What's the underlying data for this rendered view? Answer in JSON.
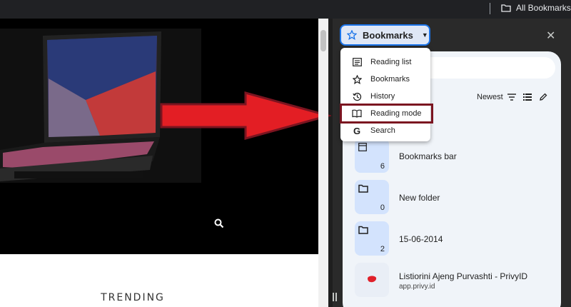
{
  "topbar": {
    "all_bookmarks_label": "All Bookmarks"
  },
  "webpage": {
    "trending_label": "TRENDING"
  },
  "side_panel": {
    "selector_label": "Bookmarks",
    "sort_label": "Newest",
    "menu": [
      {
        "label": "Reading list",
        "icon": "reading-list-icon"
      },
      {
        "label": "Bookmarks",
        "icon": "star-icon"
      },
      {
        "label": "History",
        "icon": "history-icon"
      },
      {
        "label": "Reading mode",
        "icon": "reading-mode-icon",
        "highlighted": true
      },
      {
        "label": "Search",
        "icon": "google-g-icon"
      }
    ],
    "bookmarks": [
      {
        "title": "Bookmarks bar",
        "count": "6"
      },
      {
        "title": "New folder",
        "count": "0"
      },
      {
        "title": "15-06-2014",
        "count": "2"
      },
      {
        "title": "Listiorini Ajeng Purvashti - PrivyID",
        "url": "app.privy.id"
      }
    ]
  },
  "colors": {
    "accent": "#1a73e8",
    "highlight_outline": "#7b1420",
    "arrow_red": "#e31e24"
  }
}
